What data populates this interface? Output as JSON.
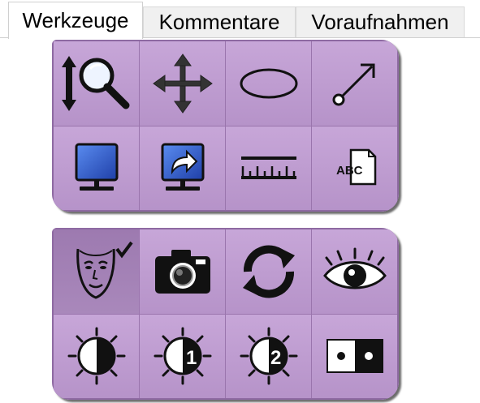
{
  "tabs": [
    {
      "label": "Werkzeuge",
      "active": true
    },
    {
      "label": "Kommentare",
      "active": false
    },
    {
      "label": "Voraufnahmen",
      "active": false
    }
  ],
  "toolboxes": [
    {
      "name": "image-tools",
      "buttons": [
        {
          "icon": "zoom-magnifier-icon",
          "pressed": false
        },
        {
          "icon": "pan-move-icon",
          "pressed": false
        },
        {
          "icon": "ellipse-icon",
          "pressed": false
        },
        {
          "icon": "arrow-annotation-icon",
          "pressed": false
        },
        {
          "icon": "monitor-icon",
          "pressed": false
        },
        {
          "icon": "monitor-share-icon",
          "pressed": false
        },
        {
          "icon": "ruler-icon",
          "pressed": false
        },
        {
          "icon": "text-annotation-icon",
          "pressed": false
        }
      ]
    },
    {
      "name": "view-tools",
      "buttons": [
        {
          "icon": "face-check-icon",
          "pressed": true
        },
        {
          "icon": "camera-icon",
          "pressed": false
        },
        {
          "icon": "refresh-icon",
          "pressed": false
        },
        {
          "icon": "eye-icon",
          "pressed": false
        },
        {
          "icon": "contrast-icon",
          "pressed": false
        },
        {
          "icon": "contrast-1-icon",
          "pressed": false
        },
        {
          "icon": "contrast-2-icon",
          "pressed": false
        },
        {
          "icon": "dots-toggle-icon",
          "pressed": false
        }
      ]
    }
  ],
  "labels": {
    "text_icon_abc": "ABC",
    "contrast_1": "1",
    "contrast_2": "2"
  },
  "colors": {
    "tool_purple": "#b693c9",
    "tool_pressed": "#9d7ab0",
    "monitor_blue": "#3f6fe0"
  }
}
